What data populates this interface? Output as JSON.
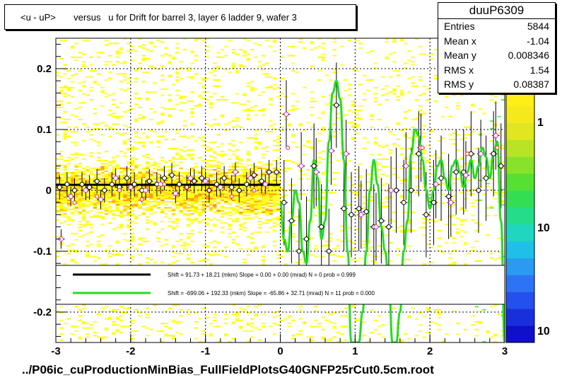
{
  "title": "<u - uP>       versus   u for Drift for barrel 3, layer 6 ladder 9, wafer 3",
  "footer": "../P06ic_cuProductionMinBias_FullFieldPlotsG40GNFP25rCut0.5cm.root",
  "stats": {
    "name": "duuP6309",
    "rows": [
      {
        "label": "Entries",
        "value": "5844"
      },
      {
        "label": "Mean x",
        "value": "-1.04"
      },
      {
        "label": "Mean y",
        "value": "0.008346"
      },
      {
        "label": "RMS x",
        "value": "1.54"
      },
      {
        "label": "RMS y",
        "value": "0.08387"
      }
    ]
  },
  "legend": {
    "black_fit": "Shift =    91.73 + 18.21 (mkm) Slope =    0.00 + 0.00 (mrad)  N = 0 prob = 0.999",
    "green_fit": "Shift =  -699.06 + 192.33 (mkm) Slope =   -65.86 + 32.71 (mrad)  N = 11 prob = 0.000"
  },
  "colors": {
    "black_fit": "#000000",
    "green_fit": "#22dd22",
    "profile_black": "#000000",
    "profile_magenta": "#cc33cc",
    "profile_red": "#ff2222"
  },
  "chart_data": {
    "type": "heatmap",
    "title": "<u - uP>       versus   u for Drift for barrel 3, layer 6 ladder 9, wafer 3",
    "xlim": [
      -3,
      3
    ],
    "ylim": [
      -0.25,
      0.25
    ],
    "x_ticks": [
      "-3",
      "-2",
      "-1",
      "0",
      "1",
      "2",
      "3"
    ],
    "y_ticks": [
      "-0.2",
      "-0.1",
      "0",
      "0.1",
      "0.2"
    ],
    "z_scale": "log",
    "z_tick_labels": [
      "1",
      "10",
      "10"
    ],
    "grid": true,
    "profile_black": {
      "x": [
        -2.95,
        -2.85,
        -2.75,
        -2.65,
        -2.55,
        -2.45,
        -2.35,
        -2.25,
        -2.15,
        -2.05,
        -1.95,
        -1.85,
        -1.75,
        -1.65,
        -1.55,
        -1.45,
        -1.35,
        -1.25,
        -1.15,
        -1.05,
        -0.95,
        -0.85,
        -0.75,
        -0.65,
        -0.55,
        -0.45,
        -0.35,
        -0.25,
        -0.15,
        -0.05,
        0.05,
        0.15,
        0.25,
        0.35,
        0.45,
        0.55,
        0.65,
        0.75,
        0.85,
        0.95,
        1.05,
        1.15,
        1.25,
        1.35,
        1.45,
        1.55,
        1.65,
        1.75,
        1.85,
        1.95,
        2.05,
        2.15,
        2.25,
        2.35,
        2.45,
        2.55,
        2.65,
        2.75,
        2.85,
        2.95
      ],
      "y": [
        0.005,
        0.01,
        0.0,
        0.01,
        0.005,
        0.015,
        0.0,
        0.01,
        0.005,
        0.02,
        0.01,
        0.0,
        0.015,
        0.01,
        0.02,
        0.025,
        0.01,
        0.005,
        0.015,
        0.02,
        0.0,
        0.01,
        0.02,
        0.005,
        0.0,
        0.01,
        0.025,
        0.015,
        0.03,
        0.03,
        -0.02,
        -0.05,
        -0.1,
        -0.08,
        0.04,
        -0.06,
        -0.1,
        0.14,
        -0.03,
        -0.04,
        -0.03,
        -0.035,
        -0.06,
        -0.05,
        -0.06,
        0.0,
        -0.02,
        0.0,
        0.06,
        -0.04,
        -0.02,
        0.02,
        -0.01,
        0.03,
        0.03,
        0.06,
        0.0,
        0.02,
        0.06,
        0.04
      ]
    },
    "profile_magenta": {
      "x": [
        -2.93,
        -2.8,
        -2.6,
        -2.4,
        -2.2,
        -2.0,
        -1.8,
        -1.6,
        -1.4,
        -1.2,
        -1.0,
        -0.8,
        -0.6,
        -0.4,
        -0.2,
        0.08,
        0.28,
        0.48,
        0.68,
        0.88,
        1.08,
        1.28,
        1.48,
        1.68,
        1.88,
        2.08,
        2.28,
        2.48,
        2.68,
        2.88
      ],
      "y": [
        -0.08,
        -0.01,
        0.0,
        -0.015,
        0.02,
        0.005,
        0.0,
        0.01,
        -0.005,
        0.02,
        0.015,
        0.005,
        0.03,
        0.02,
        0.01,
        0.125,
        0.04,
        0.03,
        0.065,
        0.06,
        -0.04,
        -0.06,
        0.0,
        0.04,
        0.07,
        0.01,
        -0.02,
        0.025,
        0.06,
        0.09
      ]
    },
    "profile_red": {
      "x": [
        -2.75,
        -2.45,
        -2.15,
        -1.85,
        -1.55,
        -1.25,
        -0.95,
        -0.65,
        -0.35,
        0.1,
        1.9,
        2.5,
        2.9
      ],
      "y": [
        -0.02,
        -0.01,
        0.0,
        -0.015,
        0.01,
        0.005,
        0.0,
        -0.01,
        0.0,
        0.07,
        0.07,
        0.06,
        0.07
      ]
    },
    "fit_black": {
      "x": [
        -3,
        0
      ],
      "y": [
        0.0092,
        0.0092
      ]
    },
    "fit_green": {
      "x": [
        0.0,
        0.05,
        0.1,
        0.15,
        0.2,
        0.25,
        0.3,
        0.35,
        0.4,
        0.45,
        0.5,
        0.55,
        0.6,
        0.65,
        0.7,
        0.75,
        0.8,
        0.85,
        0.9,
        0.95,
        1.0,
        1.05,
        1.1,
        1.15,
        1.2,
        1.25,
        1.3,
        1.35,
        1.4,
        1.45,
        1.5,
        1.55,
        1.6,
        1.65,
        1.7,
        1.75,
        1.8,
        1.85,
        1.9,
        1.95,
        2.0,
        2.05,
        2.1,
        2.15,
        2.2,
        2.25,
        2.3,
        2.35,
        2.4,
        2.45,
        2.5,
        2.55,
        2.6,
        2.65,
        2.7,
        2.75,
        2.8,
        2.85,
        2.9,
        2.95,
        3.0
      ],
      "y": [
        -0.02,
        -0.08,
        -0.1,
        -0.05,
        0.0,
        -0.02,
        -0.1,
        -0.12,
        -0.05,
        0.05,
        0.02,
        -0.08,
        -0.05,
        0.08,
        0.16,
        0.18,
        0.15,
        0.05,
        -0.1,
        -0.25,
        -0.25,
        -0.25,
        -0.2,
        -0.1,
        0.0,
        0.05,
        0.01,
        -0.06,
        -0.1,
        -0.15,
        -0.25,
        -0.25,
        -0.2,
        -0.1,
        -0.05,
        0.06,
        0.1,
        0.09,
        0.05,
        0.0,
        -0.03,
        0.0,
        0.04,
        0.05,
        0.02,
        0.0,
        0.04,
        0.05,
        0.03,
        0.005,
        0.03,
        0.05,
        0.02,
        0.04,
        0.07,
        0.055,
        0.02,
        0.06,
        0.08,
        -0.05,
        -0.25
      ]
    }
  }
}
